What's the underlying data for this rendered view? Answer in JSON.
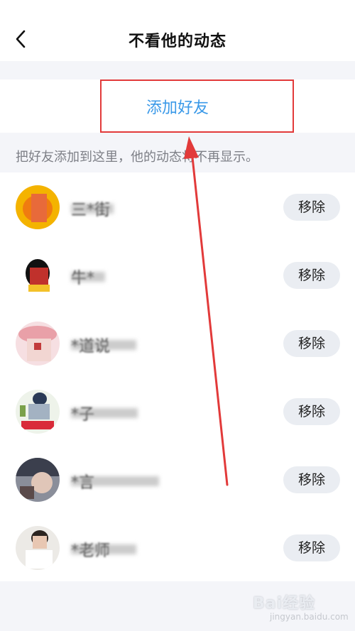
{
  "nav": {
    "title": "不看他的动态"
  },
  "add": {
    "label": "添加好友"
  },
  "hint": "把好友添加到这里，他的动态将不再显示。",
  "friends": [
    {
      "name": "三*街",
      "remove_label": "移除"
    },
    {
      "name": "牛*",
      "remove_label": "移除"
    },
    {
      "name": "*道说",
      "remove_label": "移除"
    },
    {
      "name": "*子",
      "remove_label": "移除"
    },
    {
      "name": "*言",
      "remove_label": "移除"
    },
    {
      "name": "*老师",
      "remove_label": "移除"
    }
  ],
  "watermark": {
    "text": "Bai经验",
    "sub": "jingyan.baidu.com"
  },
  "colors": {
    "accent": "#3a99e8",
    "highlight": "#e23a3a"
  },
  "icons": {
    "back": "chevron-left-icon"
  }
}
